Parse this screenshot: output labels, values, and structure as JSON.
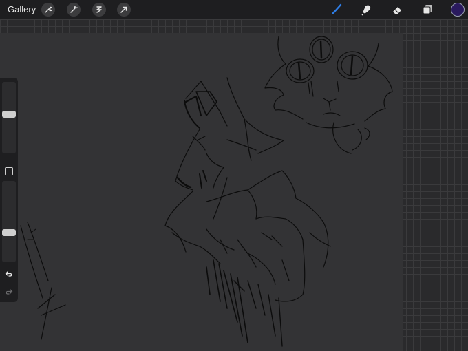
{
  "toolbar": {
    "gallery_label": "Gallery",
    "actions": [
      {
        "name": "wrench-icon"
      },
      {
        "name": "magic-wand-icon"
      },
      {
        "name": "selection-icon"
      },
      {
        "name": "transform-arrow-icon"
      }
    ],
    "tools": [
      {
        "name": "brush-icon",
        "active": true
      },
      {
        "name": "smudge-icon",
        "active": false
      },
      {
        "name": "eraser-icon",
        "active": false
      },
      {
        "name": "layers-icon",
        "active": false
      }
    ],
    "current_color": "#2a1a5e"
  },
  "sidebar": {
    "brush_size_level": 0.55,
    "opacity_level": 0.35,
    "undo_icon": "undo-icon",
    "redo_icon": "redo-icon"
  },
  "colors": {
    "active_tool": "#2f7fe8",
    "toolbar_bg": "#1e1e20",
    "canvas_bg": "#333335"
  }
}
